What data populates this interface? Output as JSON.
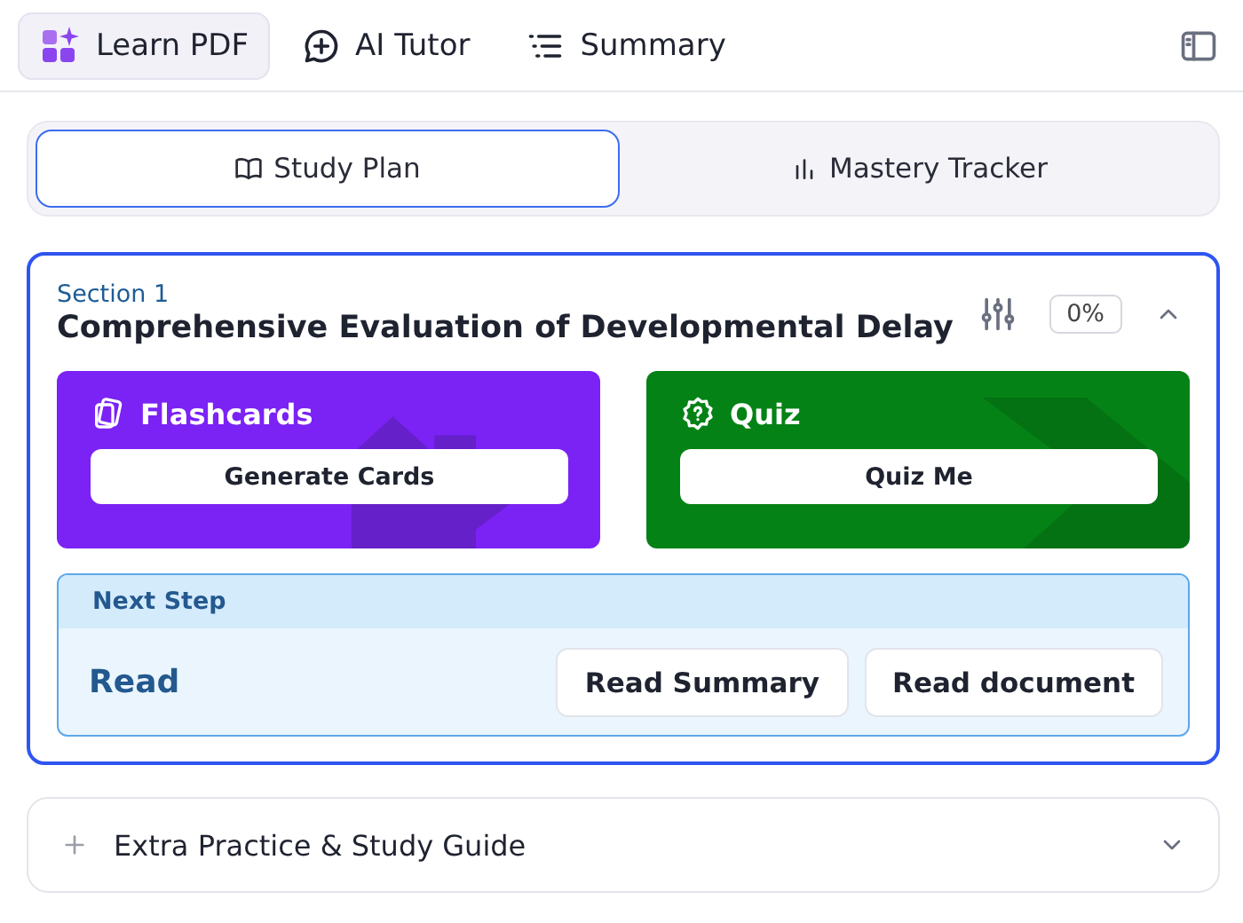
{
  "nav_tabs": [
    {
      "label": "Learn PDF",
      "selected": true
    },
    {
      "label": "AI Tutor",
      "selected": false
    },
    {
      "label": "Summary",
      "selected": false
    }
  ],
  "view_tabs": [
    {
      "label": "Study Plan",
      "selected": true
    },
    {
      "label": "Mastery Tracker",
      "selected": false
    }
  ],
  "section": {
    "eyebrow": "Section 1",
    "title": "Comprehensive Evaluation of Developmental Delay",
    "progress": "0%",
    "expanded": true,
    "cards": [
      {
        "kind": "flashcards",
        "title": "Flashcards",
        "button": "Generate Cards",
        "color": "#7b22f5"
      },
      {
        "kind": "quiz",
        "title": "Quiz",
        "button": "Quiz Me",
        "color": "#058216"
      }
    ],
    "next_step": {
      "header": "Next Step",
      "label": "Read",
      "buttons": [
        "Read Summary",
        "Read document"
      ]
    }
  },
  "extra": {
    "title": "Extra Practice & Study Guide",
    "expanded": false
  }
}
